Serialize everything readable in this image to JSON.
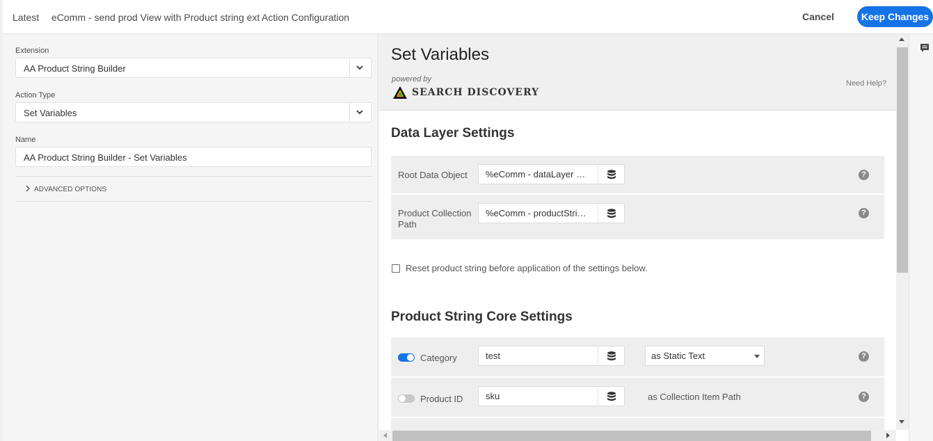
{
  "breadcrumb": {
    "root": "Latest",
    "rule": "eComm - send prod View with Product string ext",
    "current": "Action Configuration"
  },
  "toolbar": {
    "cancel_label": "Cancel",
    "keep_label": "Keep Changes"
  },
  "left_panel": {
    "extension": {
      "label": "Extension",
      "value": "AA Product String Builder"
    },
    "action_type": {
      "label": "Action Type",
      "value": "Set Variables"
    },
    "name": {
      "label": "Name",
      "value": "AA Product String Builder - Set Variables"
    },
    "advanced_label": "ADVANCED OPTIONS"
  },
  "extension_view": {
    "title": "Set Variables",
    "powered_by": "powered by",
    "brand": "SEARCH DISCOVERY",
    "need_help": "Need Help?",
    "data_layer": {
      "heading": "Data Layer Settings",
      "root_label": "Root Data Object",
      "root_value": "%eComm - dataLayer Object%",
      "collection_label": "Product Collection Path",
      "collection_value": "%eComm - productString Path%"
    },
    "reset_label": "Reset product string before application of the settings below.",
    "reset_checked": false,
    "core": {
      "heading": "Product String Core Settings",
      "category_label": "Category",
      "category_enabled": true,
      "category_value": "test",
      "category_mode": "as Static Text",
      "product_id_label": "Product ID",
      "product_id_enabled": false,
      "product_id_value": "sku",
      "product_id_mode": "as Collection Item Path"
    }
  },
  "colors": {
    "accent": "#1473e6",
    "toggle_off": "#c8c8c8"
  }
}
